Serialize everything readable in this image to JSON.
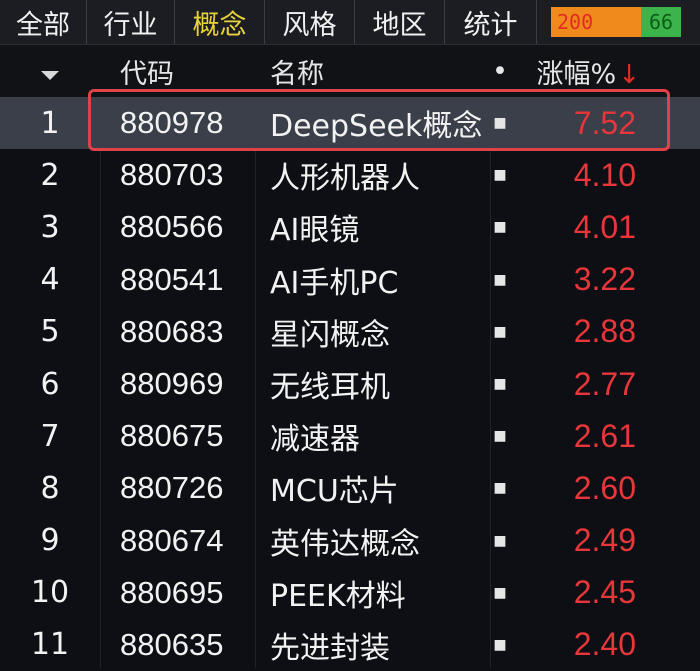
{
  "tabs": [
    {
      "label": "全部",
      "active": false
    },
    {
      "label": "行业",
      "active": false
    },
    {
      "label": "概念",
      "active": true
    },
    {
      "label": "风格",
      "active": false
    },
    {
      "label": "地区",
      "active": false
    },
    {
      "label": "统计",
      "active": false
    }
  ],
  "market_breadth": {
    "up": "200",
    "down": "66",
    "up_color": "#f08a1c",
    "down_color": "#3db34b"
  },
  "header": {
    "code": "代码",
    "name": "名称",
    "dot": "•",
    "pct": "涨幅%",
    "sort_icon": "sort-desc-icon"
  },
  "rows": [
    {
      "num": "1",
      "code": "880978",
      "name": "DeepSeek概念",
      "pct": "7.52",
      "selected": true
    },
    {
      "num": "2",
      "code": "880703",
      "name": "人形机器人",
      "pct": "4.10"
    },
    {
      "num": "3",
      "code": "880566",
      "name": "AI眼镜",
      "pct": "4.01"
    },
    {
      "num": "4",
      "code": "880541",
      "name": "AI手机PC",
      "pct": "3.22"
    },
    {
      "num": "5",
      "code": "880683",
      "name": "星闪概念",
      "pct": "2.88"
    },
    {
      "num": "6",
      "code": "880969",
      "name": "无线耳机",
      "pct": "2.77"
    },
    {
      "num": "7",
      "code": "880675",
      "name": "减速器",
      "pct": "2.61"
    },
    {
      "num": "8",
      "code": "880726",
      "name": "MCU芯片",
      "pct": "2.60"
    },
    {
      "num": "9",
      "code": "880674",
      "name": "英伟达概念",
      "pct": "2.49"
    },
    {
      "num": "10",
      "code": "880695",
      "name": "PEEK材料",
      "pct": "2.45"
    },
    {
      "num": "11",
      "code": "880635",
      "name": "先进封装",
      "pct": "2.40"
    }
  ],
  "colors": {
    "rise": "#e8363a",
    "active_tab": "#e8d23a",
    "selection_border": "#e0424a"
  }
}
